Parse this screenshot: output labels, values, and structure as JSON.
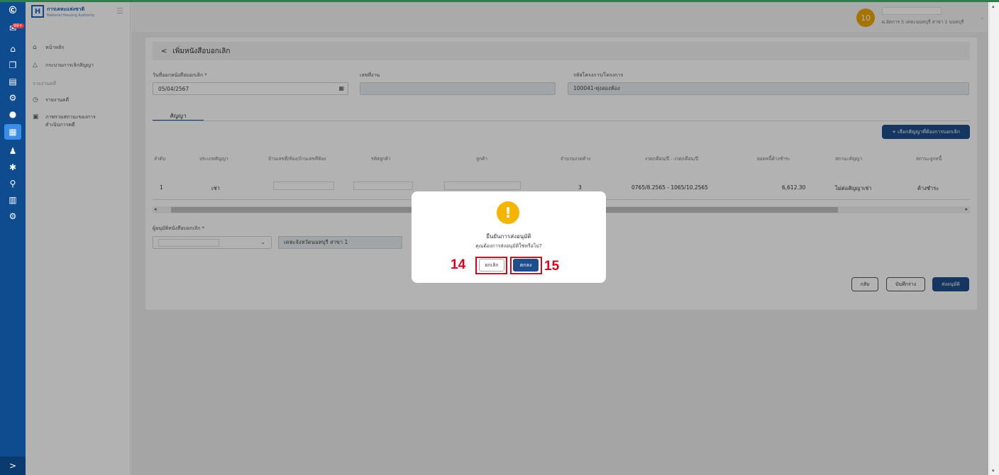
{
  "sidebar": {
    "logo_text": "การเคหะแห่งชาติ",
    "logo_subtext": "National Housing Authority",
    "menu": [
      {
        "label": "หน้าหลัก",
        "icon": "home-icon"
      },
      {
        "label": "กระบวนการเลิกสัญญา",
        "icon": "warning-triangle-icon"
      },
      {
        "label": "รายงานคดี",
        "icon": "clock-icon"
      },
      {
        "label": "ภาพรวมสถานะของการ",
        "label2": "ดำเนินการคดี",
        "icon": "document-icon"
      }
    ],
    "section_label": "รายงานคดี"
  },
  "iconbar": {
    "badge": "99+",
    "items": [
      "logo-icon",
      "mail-icon",
      "home-icon",
      "copy-icon",
      "file-icon",
      "gear-icon",
      "user-icon",
      "dashboard-icon",
      "group-icon",
      "settings-icon",
      "search-icon",
      "chart-icon",
      "cogs-icon"
    ],
    "expand_label": ">"
  },
  "header": {
    "avatar_text": "10",
    "user_sub": "ผ.อัตการ 5 เคหะนนทบุรี สาขา 1 นนทบุรี"
  },
  "page": {
    "title": "เพิ่มหนังสือบอกเลิก",
    "back_label": "<",
    "fields": {
      "notice_date_label": "วันที่ออกหนังสือบอกเลิก *",
      "notice_date_value": "05/04/2567",
      "doc_no_label": "เลขที่งาน",
      "doc_no_value": "",
      "project_label": "รหัสโครงการ/โครงการ",
      "project_value": "100041-ทุ่งสองห้อง"
    },
    "tab_label": "สัญญา",
    "add_button": "+ เลือกสัญญาที่ต้องการบอกเลิก",
    "table": {
      "headers": [
        "ลำดับ",
        "ประเภทสัญญา",
        "บ้านเลขที่/ห้อง/บ้านเลขที่ห้อง",
        "รหัสลูกค้า",
        "ลูกค้า",
        "จำนวนงวดค้าง",
        "งวด/เดือน/ปี - งวด/เดือน/ปี",
        "ยอดหนี้ค้างชำระ",
        "สถานะสัญญา",
        "สถานะลูกหนี้"
      ],
      "rows": [
        {
          "no": "1",
          "type": "เช่า",
          "periods": "3",
          "range": "0765/8.2565 - 1065/10.2565",
          "debt": "6,612.30",
          "contract_status": "ไม่ต่อสัญญาเช่า",
          "debtor_status": "ค้างชำระ"
        }
      ]
    },
    "approver_label": "ผู้อนุมัติหนังสือบอกเลิก *",
    "approver_position": "เคหะจังหวัดนนทบุรี สาขา 1",
    "buttons": {
      "back": "กลับ",
      "draft": "บันทึกร่าง",
      "submit": "ส่งอนุมัติ"
    }
  },
  "modal": {
    "icon": "!",
    "title": "ยืนยันการส่งอนุมัติ",
    "message": "คุณต้องการส่งอนุมัติใช่หรือไม่?",
    "cancel_label": "ยกเลิก",
    "ok_label": "ตกลง"
  },
  "annotations": {
    "step_cancel": "14",
    "step_ok": "15",
    "highlight_color": "#e0001b"
  },
  "colors": {
    "primary": "#1f4e8c",
    "iconbar": "#0f4c8f",
    "warning": "#f5b400"
  }
}
